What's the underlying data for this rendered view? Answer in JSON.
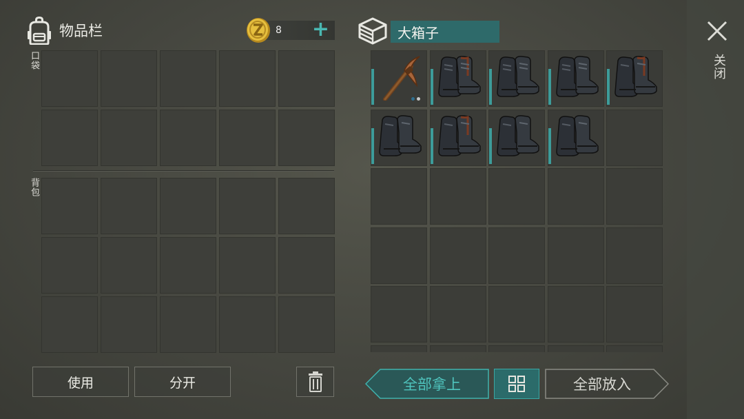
{
  "inventory": {
    "title": "物品栏",
    "coins": "8",
    "pocket_label": "口袋",
    "backpack_label": "背包"
  },
  "actions": {
    "use_label": "使用",
    "split_label": "分开"
  },
  "container": {
    "name": "大箱子",
    "close_label": "关闭",
    "take_all_label": "全部拿上",
    "put_all_label": "全部放入",
    "items": [
      {
        "name": "pickaxe",
        "icon": "pickaxe-icon"
      },
      {
        "name": "boots",
        "icon": "boots-icon"
      },
      {
        "name": "boots",
        "icon": "boots-icon"
      },
      {
        "name": "boots",
        "icon": "boots-icon"
      },
      {
        "name": "boots",
        "icon": "boots-icon"
      },
      {
        "name": "boots",
        "icon": "boots-icon"
      },
      {
        "name": "boots",
        "icon": "boots-icon"
      },
      {
        "name": "boots",
        "icon": "boots-icon"
      },
      {
        "name": "boots",
        "icon": "boots-icon"
      }
    ]
  },
  "colors": {
    "accent": "#3d9c9a",
    "chest_name_bg": "#2e6a6a",
    "coin": "#e0b83a"
  }
}
